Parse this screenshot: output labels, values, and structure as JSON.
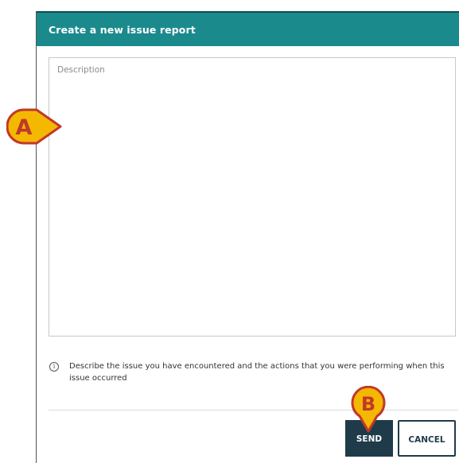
{
  "dialog": {
    "title": "Create a new issue report",
    "description_placeholder": "Description",
    "description_value": "",
    "hint": "Describe the issue you have encountered and the actions that you were performing when this issue occurred",
    "info_icon": "info-circle-icon"
  },
  "buttons": {
    "send_label": "SEND",
    "cancel_label": "CANCEL"
  },
  "callouts": {
    "a_label": "A",
    "b_label": "B"
  },
  "colors": {
    "header": "#1b8a8d",
    "button_dark": "#1f3b4a",
    "callout_fill": "#f5b800",
    "callout_stroke": "#c0392b"
  }
}
